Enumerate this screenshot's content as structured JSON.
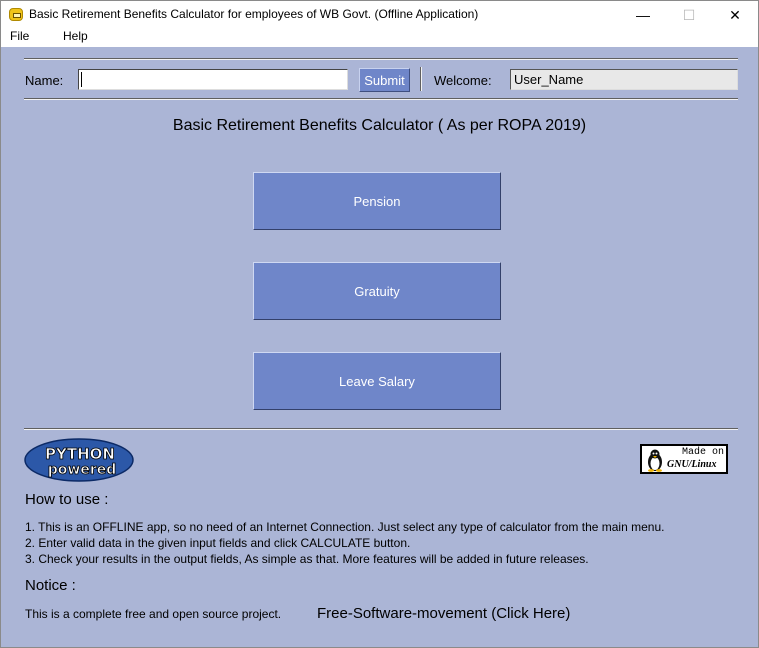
{
  "window": {
    "title": "Basic Retirement Benefits Calculator for employees of WB Govt. (Offline Application)",
    "controls": {
      "minimize": "—",
      "maximize": "☐",
      "close": "✕"
    }
  },
  "menu": [
    "File",
    "Help"
  ],
  "top_bar": {
    "name_label": "Name:",
    "name_value": "",
    "submit_label": "Submit",
    "welcome_label": "Welcome:",
    "welcome_value": "User_Name"
  },
  "heading": "Basic Retirement Benefits Calculator ( As per ROPA 2019)",
  "calculators": [
    "Pension",
    "Gratuity",
    "Leave Salary"
  ],
  "logos": {
    "python": [
      "PYTHON",
      "powered"
    ],
    "gnu_linux": [
      "Made on",
      "GNU/Linux"
    ]
  },
  "how_to_use": {
    "title": "How to use :",
    "steps": [
      "1. This is an OFFLINE app, so no need of an Internet Connection. Just select any type of calculator from the main menu.",
      "2. Enter valid data in the given input fields and click CALCULATE button.",
      "3. Check your results in the output fields, As simple as that. More features will be added in future releases."
    ]
  },
  "notice": {
    "title": "Notice :",
    "text": "This is a complete free and open source project.",
    "link": "Free-Software-movement (Click Here)"
  },
  "colors": {
    "background": "#abb5d6",
    "button": "#6f86c9",
    "button_text": "#ffffff"
  },
  "icons": {
    "app": "calculator-app-icon",
    "python": "python-powered-logo",
    "linux": "tux-penguin-icon"
  }
}
